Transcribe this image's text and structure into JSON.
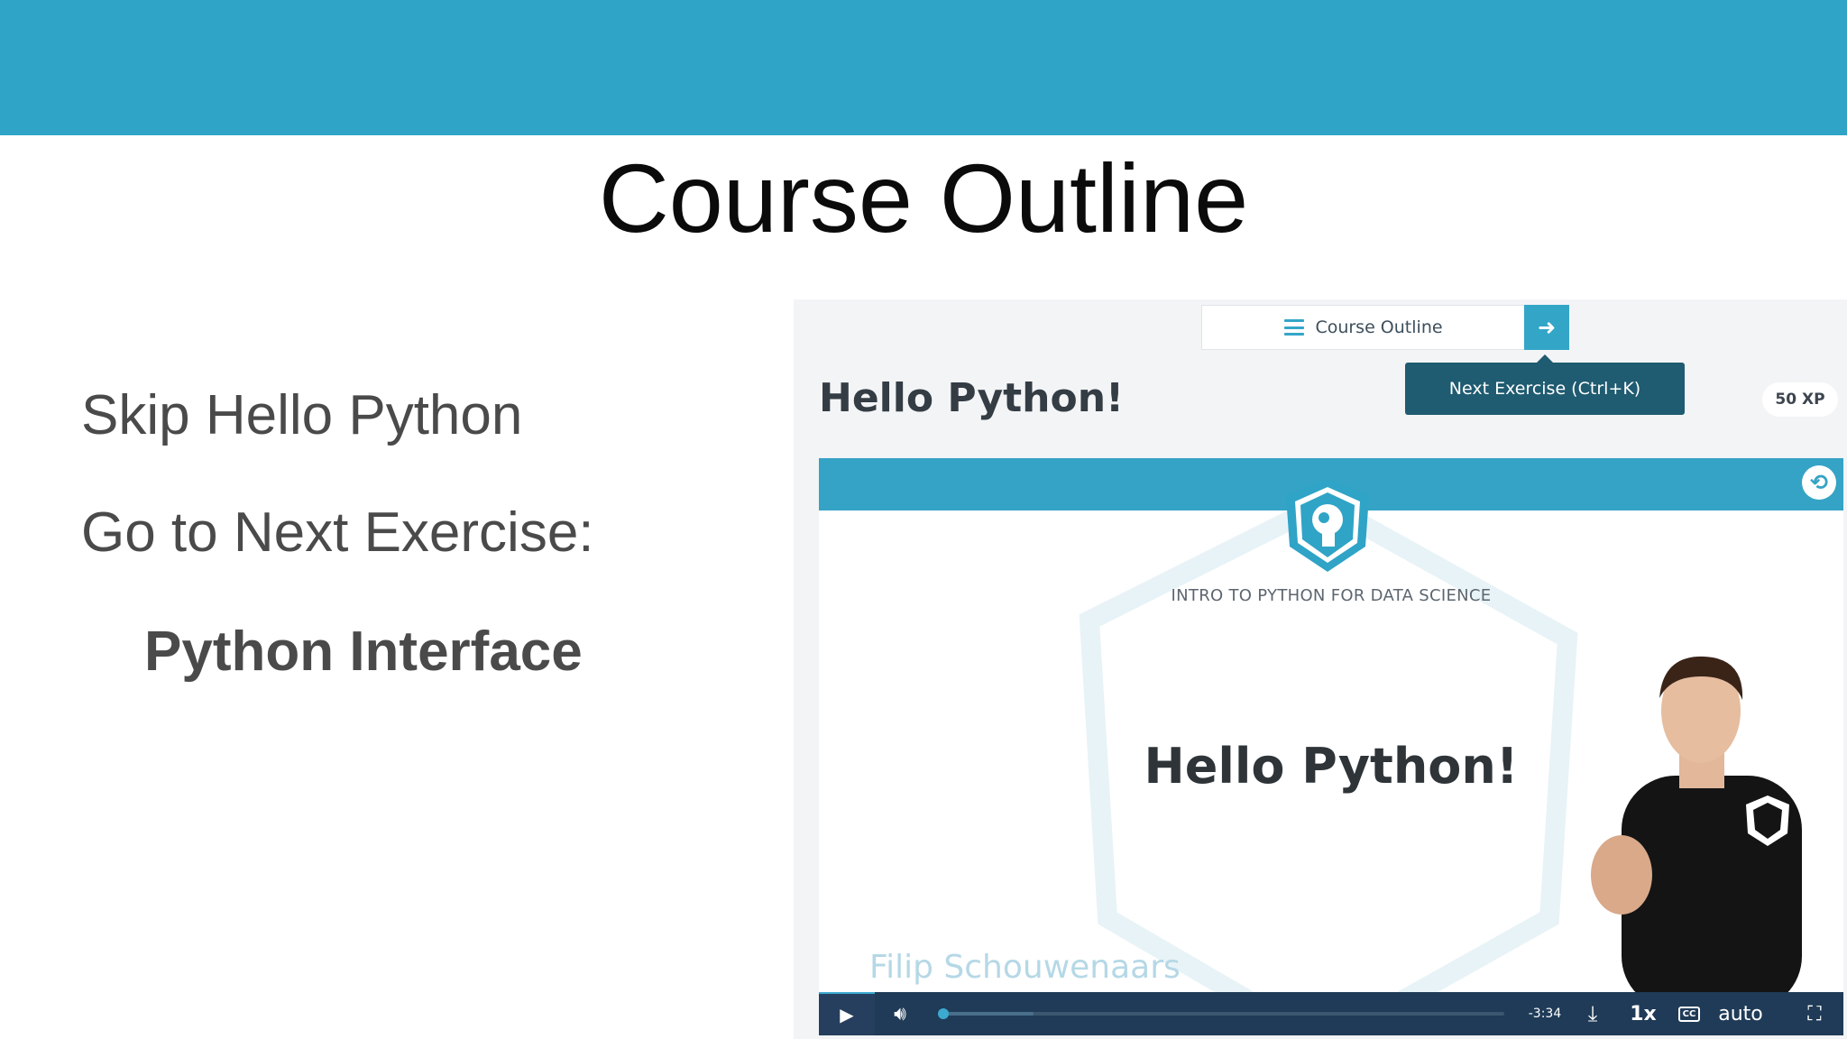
{
  "slide": {
    "title": "Course Outline",
    "bullets": [
      "Skip Hello Python",
      "Go to Next Exercise:",
      "Python Interface"
    ]
  },
  "panel": {
    "outline_label": "Course Outline",
    "next_arrow": "➜",
    "tooltip": "Next Exercise (Ctrl+K)",
    "exercise_title": "Hello Python!",
    "xp": "50 XP",
    "video": {
      "course_name": "INTRO TO PYTHON FOR DATA SCIENCE",
      "title": "Hello Python!",
      "presenter": "Filip Schouwenaars",
      "player": {
        "time_remaining": "-3:34",
        "speed": "1x",
        "cc": "CC",
        "quality": "auto",
        "progress": 0.16,
        "played": 0.0
      }
    }
  },
  "colors": {
    "brand": "#2fa4c6",
    "tooltip_bg": "#1f5b71",
    "player_bg": "#1f3b57"
  },
  "icons": [
    "hamburger-icon",
    "arrow-right-icon",
    "python-icon",
    "datacamp-shield-icon",
    "play-icon",
    "volume-icon",
    "download-icon",
    "captions-icon",
    "fullscreen-icon"
  ]
}
